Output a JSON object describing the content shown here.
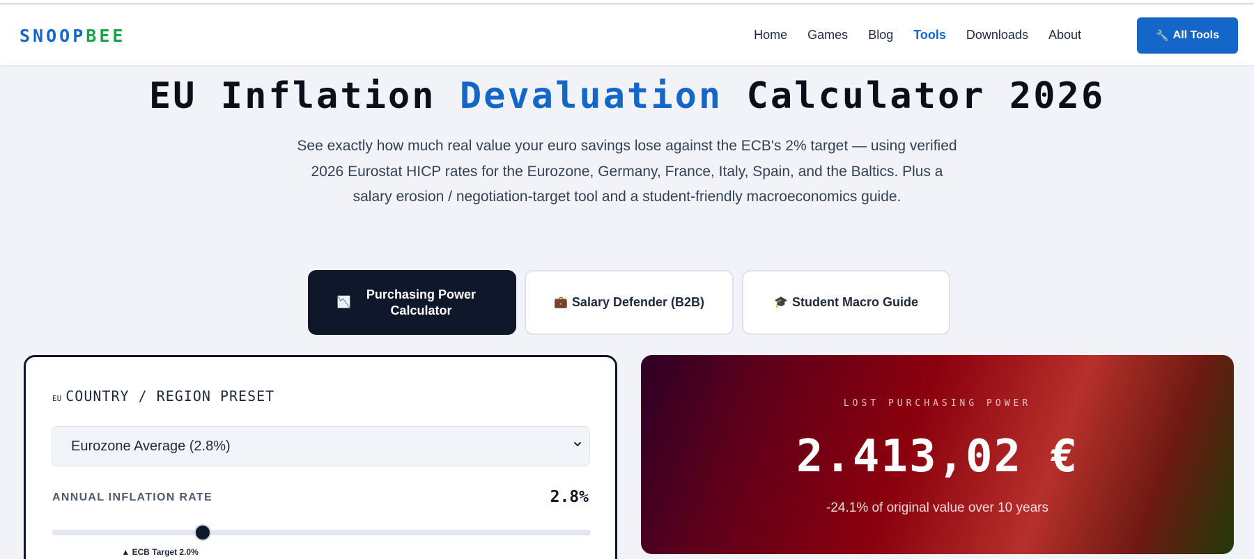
{
  "brand": {
    "part1": "SNOOP",
    "part2": "BEE"
  },
  "nav": {
    "items": [
      {
        "label": "Home"
      },
      {
        "label": "Games"
      },
      {
        "label": "Blog"
      },
      {
        "label": "Tools"
      },
      {
        "label": "Downloads"
      },
      {
        "label": "About"
      }
    ],
    "active": "Tools",
    "cta": {
      "label": "All Tools",
      "icon": "wrench-icon"
    }
  },
  "hero": {
    "title_pre": "EU Inflation ",
    "title_highlight": "Devaluation",
    "title_post": " Calculator 2026",
    "subtitle": "See exactly how much real value your euro savings lose against the ECB's 2% target — using verified 2026 Eurostat HICP rates for the Eurozone, Germany, France, Italy, Spain, and the Baltics. Plus a salary erosion / negotiation-target tool and a student-friendly macroeconomics guide."
  },
  "tabs": [
    {
      "icon": "📉",
      "label": "Purchasing Power Calculator",
      "active": true
    },
    {
      "icon": "💼",
      "label": "Salary Defender (B2B)",
      "active": false
    },
    {
      "icon": "🎓",
      "label": "Student Macro Guide",
      "active": false
    }
  ],
  "calculator": {
    "region_flag": "EU",
    "region_label": "COUNTRY / REGION PRESET",
    "region_selected": "Eurozone Average (2.8%)",
    "rate_label": "ANNUAL INFLATION RATE",
    "rate_display": "2.8%",
    "slider_fraction": 0.28,
    "ecb_marker_fraction": 0.2,
    "ecb_marker_label": "▲ ECB Target 2.0%"
  },
  "result": {
    "label": "LOST PURCHASING POWER",
    "amount": "2.413,02 €",
    "detail": "-24.1% of original value over 10 years"
  },
  "colors": {
    "accent": "#1467c9",
    "brand_green": "#18a34a",
    "dark": "#0f172a"
  }
}
